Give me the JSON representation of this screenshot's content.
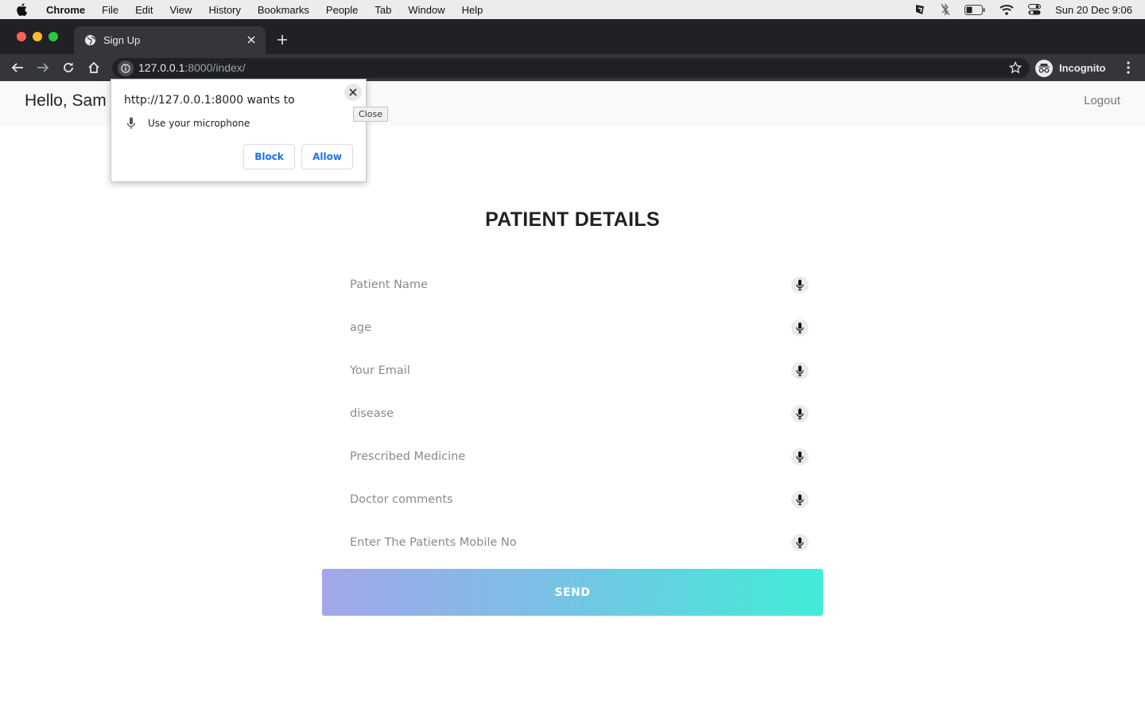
{
  "menubar": {
    "app_name": "Chrome",
    "items": [
      "File",
      "Edit",
      "View",
      "History",
      "Bookmarks",
      "People",
      "Tab",
      "Window",
      "Help"
    ],
    "clock": "Sun 20 Dec  9:06"
  },
  "browser": {
    "tab_title": "Sign Up",
    "url_host": "127.0.0.1",
    "url_rest": ":8000/index/",
    "profile_label": "Incognito"
  },
  "navbar": {
    "greeting": "Hello, Sam",
    "logout_label": "Logout"
  },
  "form": {
    "title": "PATIENT DETAILS",
    "fields": [
      {
        "placeholder": "Patient Name"
      },
      {
        "placeholder": "age"
      },
      {
        "placeholder": "Your Email"
      },
      {
        "placeholder": "disease"
      },
      {
        "placeholder": "Prescribed Medicine"
      },
      {
        "placeholder": "Doctor comments"
      },
      {
        "placeholder": "Enter The Patients Mobile No"
      }
    ],
    "submit_label": "SEND"
  },
  "permission_prompt": {
    "title": "http://127.0.0.1:8000 wants to",
    "request": "Use your microphone",
    "block_label": "Block",
    "allow_label": "Allow",
    "close_tooltip": "Close"
  },
  "colors": {
    "button_gradient_start": "#a2a7ea",
    "button_gradient_end": "#41ecd8",
    "navbar_bg": "#f8f9fa",
    "prompt_button_text": "#1a73e8"
  }
}
